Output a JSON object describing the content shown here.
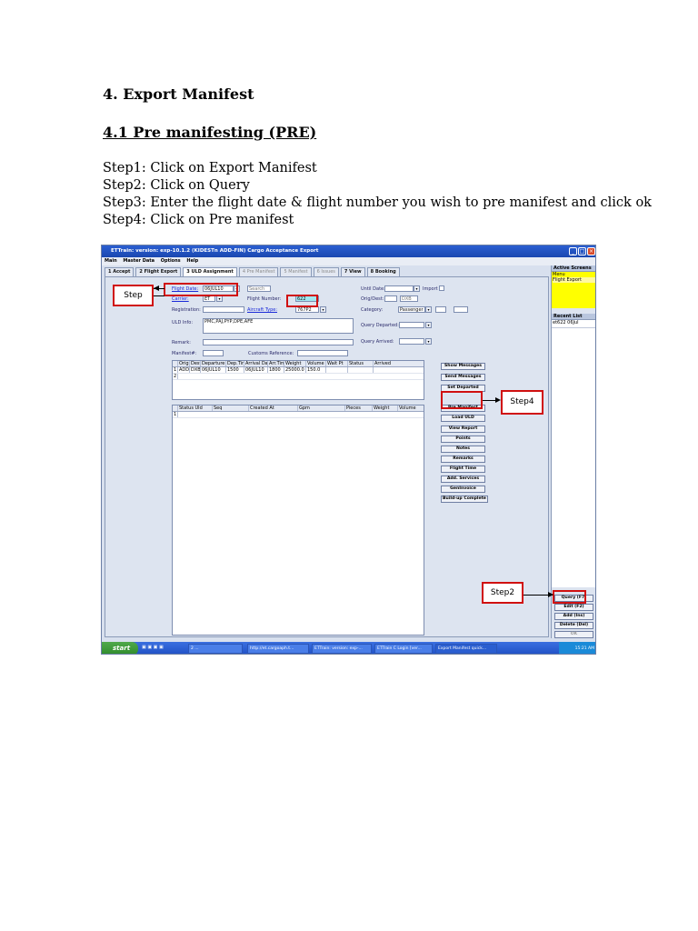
{
  "doc": {
    "heading": "4. Export Manifest",
    "subheading": "4.1 Pre manifesting (PRE)",
    "steps": [
      "Step1: Click on Export Manifest",
      "Step2: Click on Query",
      "Step3: Enter the flight date & flight number you wish to pre manifest and click ok",
      "Step4: Click on Pre manifest"
    ]
  },
  "app": {
    "title": "ETTrain: version: exp-10.1.2 (KIDESTn ADD-FIN) Cargo Acceptance Export",
    "menu": [
      "Main",
      "Master Data",
      "Options",
      "Help"
    ],
    "tabs": [
      {
        "label": "1 Accept",
        "state": "normal"
      },
      {
        "label": "2 Flight Export",
        "state": "normal"
      },
      {
        "label": "3 ULD Assignment",
        "state": "active"
      },
      {
        "label": "4 Pre Manifest",
        "state": "dim"
      },
      {
        "label": "5 Manifest",
        "state": "dim"
      },
      {
        "label": "6 Issues",
        "state": "dim"
      },
      {
        "label": "7 View",
        "state": "normal"
      },
      {
        "label": "8 Booking",
        "state": "normal"
      }
    ],
    "form": {
      "flight_date_label": "Flight Date:",
      "flight_date_value": "06JUL10",
      "search_label": "Search",
      "carrier_label": "Carrier:",
      "carrier_value": "ET",
      "flight_number_label": "Flight Number:",
      "flight_number_value": "622",
      "registration_label": "Registration:",
      "aircraft_type_label": "Aircraft Type:",
      "aircraft_type_value": "767P2",
      "uld_info_label": "ULD Info:",
      "uld_info_value": "PMC,PAJ,PYP,DPE,AFE",
      "remark_label": "Remark:",
      "manifest_label": "Manifest#:",
      "customs_ref_label": "Customs Reference:",
      "until_date_label": "Until Date:",
      "import_label": "Import",
      "orig_dest_label": "Orig/Dest:",
      "orig_dest_value": "DXB",
      "category_label": "Category:",
      "category_value": "Passenger",
      "query_departed_label": "Query Departed:",
      "query_arrived_label": "Query Arrived:"
    },
    "flight_grid": {
      "headers": [
        "Origin",
        "Dest",
        "Departure",
        "Dep.Time",
        "Arrival Date",
        "Arr.Time",
        "Weight",
        "Volume",
        "Wait Pt",
        "Status",
        "Arrived"
      ],
      "rows": [
        [
          "ADD",
          "DXB",
          "06JUL10",
          "1500",
          "06JUL10",
          "1800",
          "25000.0",
          "150.0",
          "",
          "",
          ""
        ]
      ]
    },
    "uld_grid": {
      "headers": [
        "Status Uld",
        "Seq",
        "Created At",
        "Gpm",
        "Pieces",
        "Weight",
        "Volume"
      ]
    },
    "action_buttons": [
      "Show Messages",
      "Send Messages",
      "Set Departed",
      "Pre Manifest",
      "Load ULD",
      "View Report",
      "Points",
      "Notes",
      "Remarks",
      "Flight Time",
      "Add. Services",
      "GenInvoice",
      "Build-up Complete"
    ],
    "right_panel": {
      "title": "Active Screens",
      "items": [
        "Menu",
        "Flight Export"
      ],
      "recent_title": "Recent List",
      "recent_items": [
        "et622 06Jul"
      ],
      "buttons": [
        "Query (F7)",
        "Edit (F2)",
        "Add (Ins)",
        "Delete (Del)",
        "OK"
      ]
    },
    "taskbar": {
      "start": "start",
      "tasks": [
        "2 ...",
        "http://et.cargoaph.t...",
        "ETTrain: version: exp-...",
        "ETTrain C Login [ver...",
        "Export Manifest quick..."
      ],
      "clock": "15:21 AM"
    }
  },
  "annotations": {
    "step_label": "Step",
    "step2_label": "Step2",
    "step4_label": "Step4"
  }
}
